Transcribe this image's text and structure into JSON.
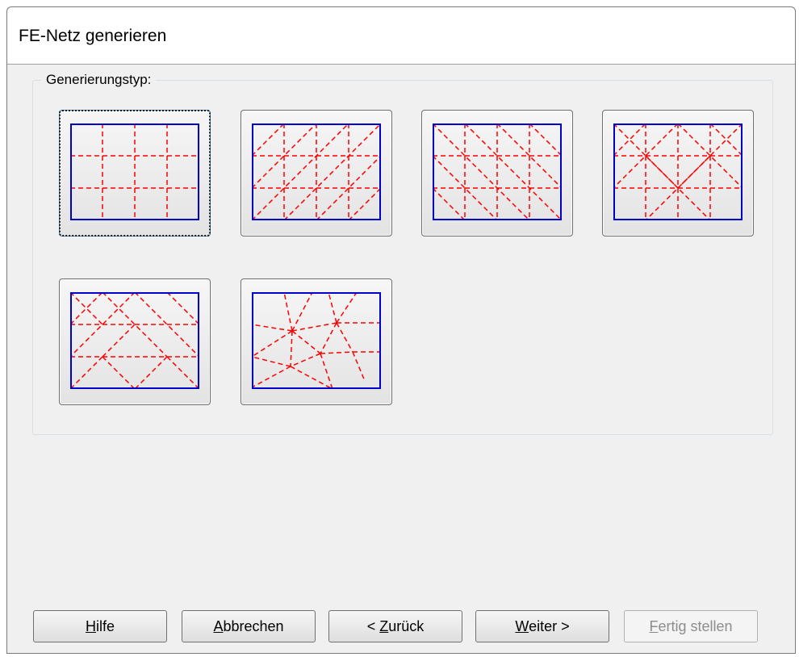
{
  "window": {
    "title": "FE-Netz generieren"
  },
  "group": {
    "legend": "Generierungstyp:"
  },
  "mesh_types": [
    {
      "id": "type-1",
      "icon": "rectangular-grid-mesh",
      "selected": true
    },
    {
      "id": "type-2",
      "icon": "diagonal-grid-mesh",
      "selected": false
    },
    {
      "id": "type-3",
      "icon": "star-diagonal-mesh",
      "selected": false
    },
    {
      "id": "type-4",
      "icon": "mixed-star-mesh",
      "selected": false
    },
    {
      "id": "type-5",
      "icon": "diamond-mesh",
      "selected": false
    },
    {
      "id": "type-6",
      "icon": "free-triangulated-mesh",
      "selected": false
    }
  ],
  "buttons": {
    "help": {
      "pre": "",
      "accel": "H",
      "post": "ilfe"
    },
    "cancel": {
      "pre": "",
      "accel": "A",
      "post": "bbrechen"
    },
    "back": {
      "pre": "< ",
      "accel": "Z",
      "post": "urück"
    },
    "next": {
      "pre": "",
      "accel": "W",
      "post": "eiter >"
    },
    "finish": {
      "pre": "",
      "accel": "F",
      "post": "ertig stellen",
      "disabled": true
    }
  },
  "colors": {
    "mesh_border": "#0000cc",
    "mesh_lines": "#ff0000"
  }
}
